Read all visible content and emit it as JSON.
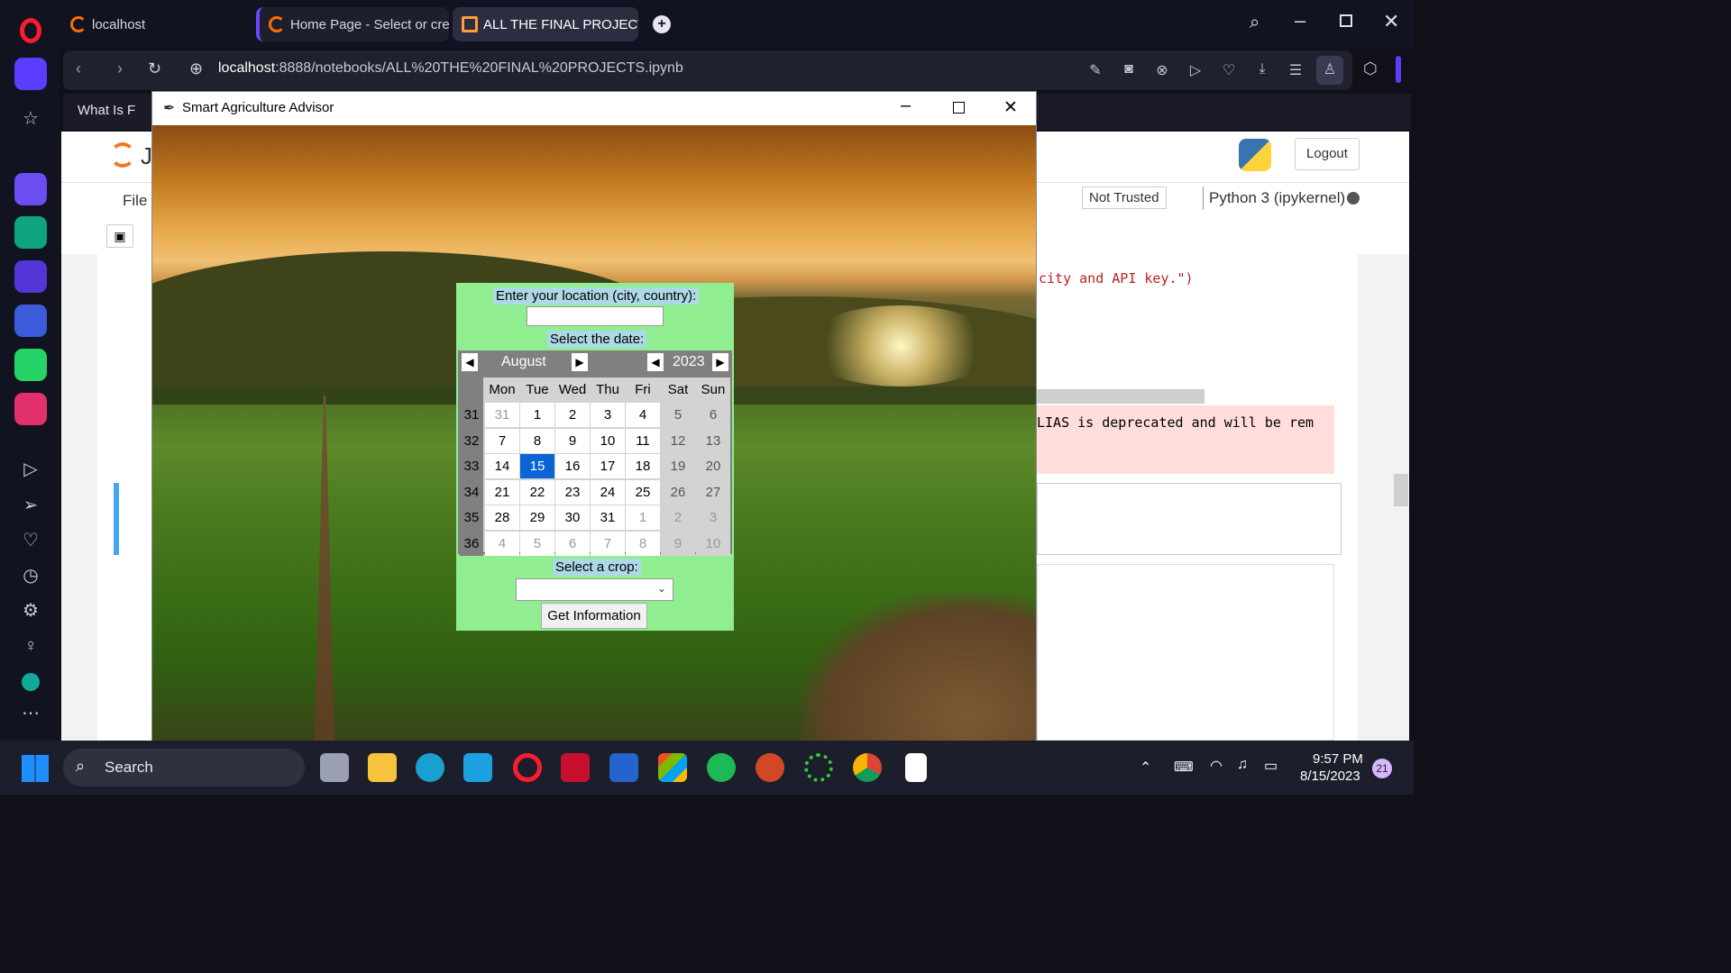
{
  "browser": {
    "tabs": [
      {
        "label": "localhost"
      },
      {
        "label": "Home Page - Select or cre"
      },
      {
        "label": "ALL THE FINAL PROJECTS"
      }
    ],
    "url_host": "localhost",
    "url_rest": ":8888/notebooks/ALL%20THE%20FINAL%20PROJECTS.ipynb",
    "bookmark_partial": "What Is F"
  },
  "jupyter": {
    "logo_partial": "J",
    "logout_label": "Logout",
    "menu_file": "File",
    "trust_label": "Not Trusted",
    "kernel_label": "Python 3 (ipykernel)",
    "code_line_1": "city and API key.\")",
    "warning_line": "LIAS is deprecated and will be rem"
  },
  "app": {
    "title": "Smart Agriculture Advisor",
    "location_label": "Enter your location (city, country):",
    "location_value": "",
    "date_label": "Select the date:",
    "crop_label": "Select a crop:",
    "crop_value": "",
    "button_label": "Get Information",
    "calendar": {
      "month": "August",
      "year": "2023",
      "weekdays": [
        "Mon",
        "Tue",
        "Wed",
        "Thu",
        "Fri",
        "Sat",
        "Sun"
      ],
      "weeks": [
        {
          "num": "31",
          "days": [
            "31",
            "1",
            "2",
            "3",
            "4",
            "5",
            "6"
          ]
        },
        {
          "num": "32",
          "days": [
            "7",
            "8",
            "9",
            "10",
            "11",
            "12",
            "13"
          ]
        },
        {
          "num": "33",
          "days": [
            "14",
            "15",
            "16",
            "17",
            "18",
            "19",
            "20"
          ]
        },
        {
          "num": "34",
          "days": [
            "21",
            "22",
            "23",
            "24",
            "25",
            "26",
            "27"
          ]
        },
        {
          "num": "35",
          "days": [
            "28",
            "29",
            "30",
            "31",
            "1",
            "2",
            "3"
          ]
        },
        {
          "num": "36",
          "days": [
            "4",
            "5",
            "6",
            "7",
            "8",
            "9",
            "10"
          ]
        }
      ],
      "selected_day": "15"
    }
  },
  "taskbar": {
    "search_placeholder": "Search",
    "time": "9:57 PM",
    "date": "8/15/2023",
    "notification_count": "21"
  }
}
